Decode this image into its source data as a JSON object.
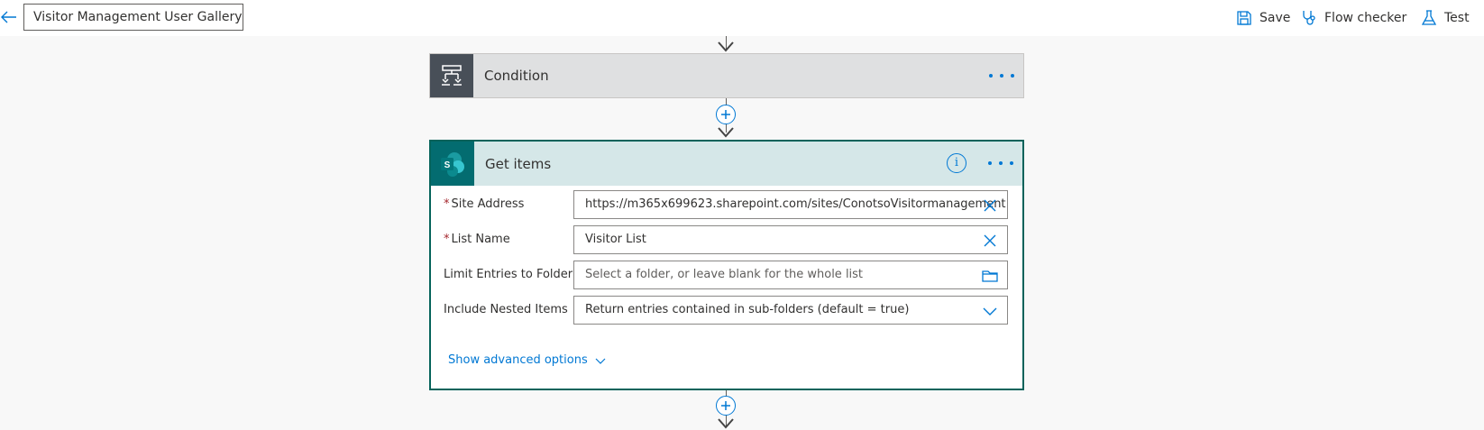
{
  "header": {
    "flow_name": "Visitor Management User Gallery",
    "commands": {
      "save": "Save",
      "flow_checker": "Flow checker",
      "test": "Test"
    }
  },
  "steps": {
    "condition": {
      "title": "Condition",
      "icon": "condition-icon"
    },
    "get_items": {
      "title": "Get items",
      "icon": "sharepoint-icon",
      "icon_letter": "S",
      "params": {
        "site_address": {
          "label": "Site Address",
          "required": "*",
          "value": "https://m365x699623.sharepoint.com/sites/ConotsoVisitormanagement"
        },
        "list_name": {
          "label": "List Name",
          "required": "*",
          "value": "Visitor List"
        },
        "limit_folder": {
          "label": "Limit Entries to Folder",
          "placeholder": "Select a folder, or leave blank for the whole list"
        },
        "nested_items": {
          "label": "Include Nested Items",
          "value": "Return entries contained in sub-folders (default = true)"
        }
      },
      "advanced_label": "Show advanced options"
    }
  },
  "colors": {
    "accent": "#0078d4",
    "sharepoint_teal": "#036c70",
    "card_border": "#06635b",
    "required": "#a4262c"
  }
}
